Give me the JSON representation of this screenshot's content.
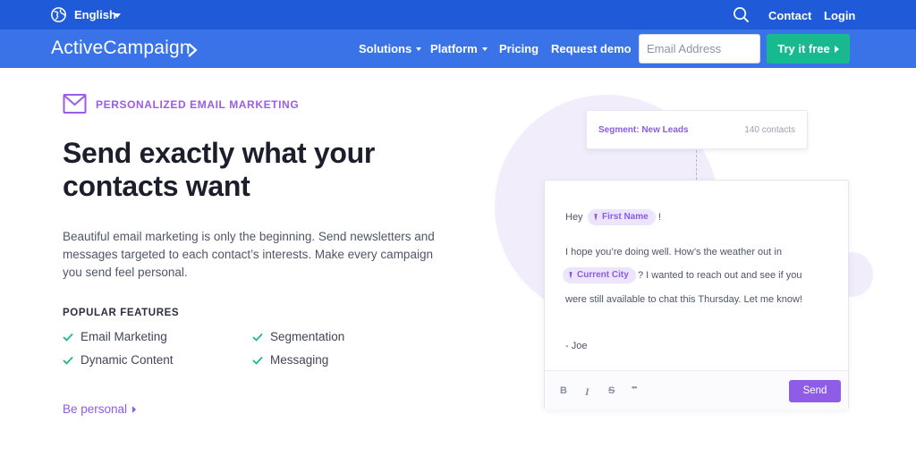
{
  "topbar": {
    "language": "English",
    "links": [
      "Contact",
      "Login"
    ]
  },
  "nav": {
    "logo": "ActiveCampaign",
    "items": [
      "Solutions",
      "Platform",
      "Pricing",
      "Request demo"
    ],
    "email_placeholder": "Email Address",
    "cta": "Try it free"
  },
  "hero": {
    "eyebrow": "PERSONALIZED EMAIL MARKETING",
    "headline": "Send exactly what your contacts want",
    "description": "Beautiful email marketing is only the beginning. Send newsletters and messages targeted to each contact’s interests. Make every campaign you send feel personal.",
    "features_heading": "POPULAR FEATURES",
    "features": [
      "Email Marketing",
      "Segmentation",
      "Dynamic Content",
      "Messaging"
    ],
    "link": "Be personal"
  },
  "illustration": {
    "segment_label": "Segment: New Leads",
    "segment_count": "140 contacts",
    "greeting": "Hey",
    "first_name_tag": "First Name",
    "exclaim": "!",
    "line1": "I hope you’re doing well. How’s the weather out in",
    "city_tag": "Current City",
    "line2": "? I wanted to reach out and see if you",
    "line3": "were still available to chat this Thursday. Let me know!",
    "signature": "- Joe",
    "toolbar": [
      "B",
      "I",
      "S",
      "•••"
    ],
    "send": "Send"
  },
  "colors": {
    "topbar": "#1f5bd9",
    "navbar": "#3a73e8",
    "cta": "#19b98f",
    "accent_purple": "#8b5ce6",
    "check_green": "#19b98f"
  }
}
